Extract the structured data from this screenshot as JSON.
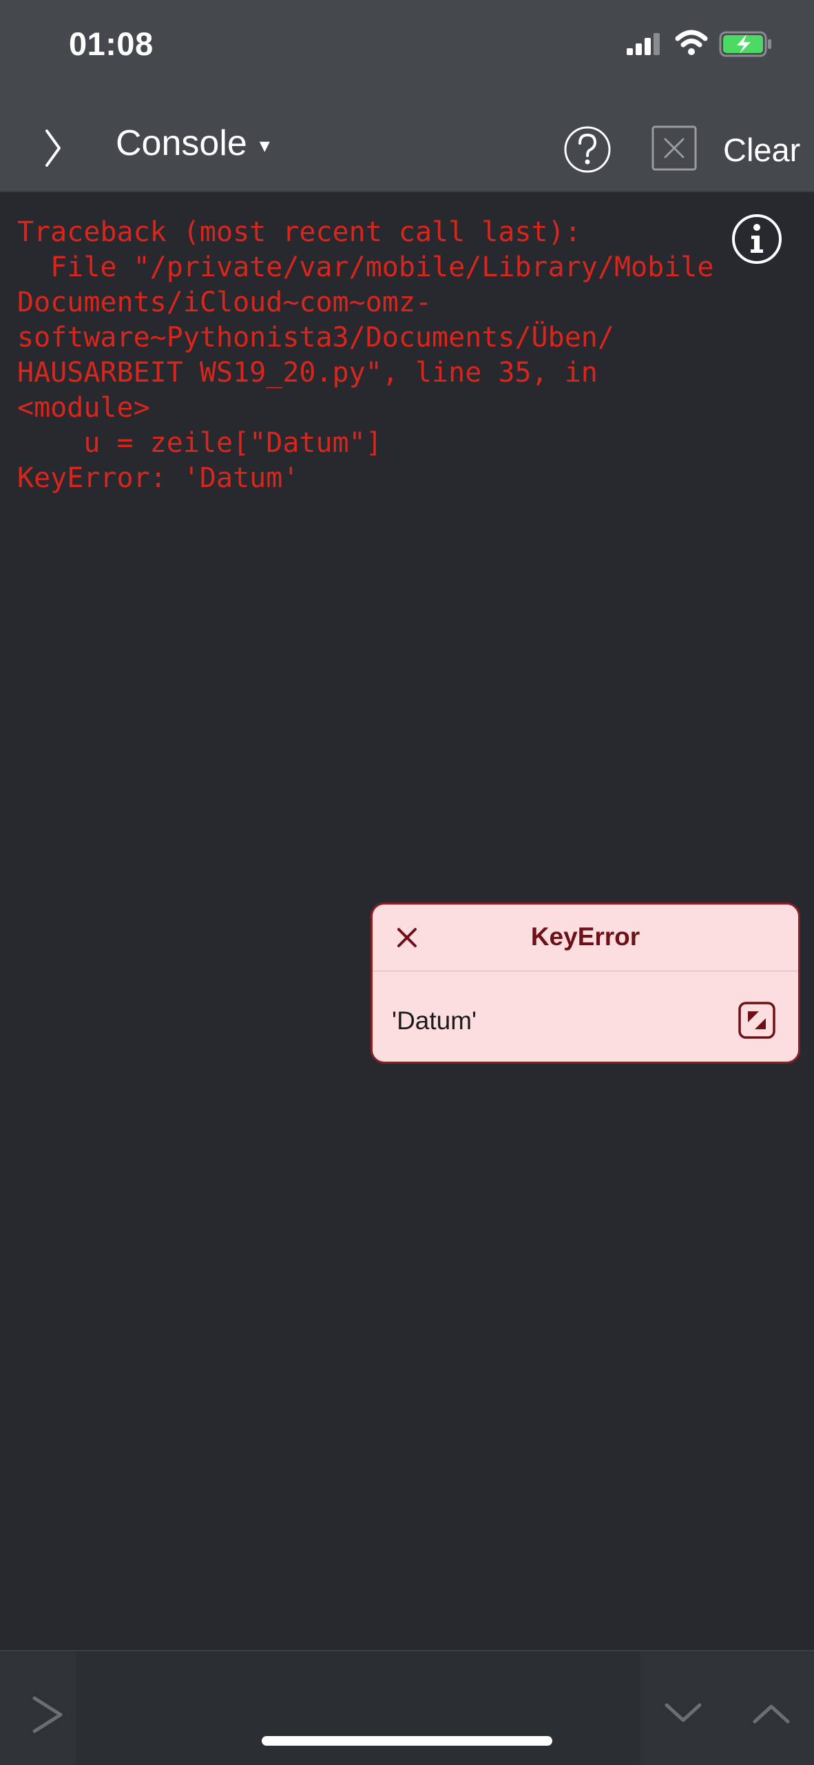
{
  "status_bar": {
    "time": "01:08"
  },
  "toolbar": {
    "title": "Console",
    "title_caret": "▾",
    "clear_label": "Clear"
  },
  "console": {
    "lines": [
      "Traceback (most recent call last):",
      "  File \"/private/var/mobile/Library/Mobile",
      "Documents/iCloud~com~omz-",
      "software~Pythonista3/Documents/Üben/",
      "HAUSARBEIT WS19_20.py\", line 35, in",
      "<module>",
      "    u = zeile[\"Datum\"]",
      "KeyError: 'Datum'"
    ],
    "text_color": "#d9261c"
  },
  "error_popup": {
    "title": "KeyError",
    "message": "'Datum'",
    "background": "#fcdee0",
    "border": "#8a1f26"
  },
  "colors": {
    "background": "#27292e",
    "toolbar": "#45484d",
    "battery_fill": "#4cd964"
  },
  "icons": {
    "sidebar_toggle": "chevron-right-icon",
    "help": "question-circle-icon",
    "clear": "x-square-icon",
    "info": "info-circle-icon",
    "popup_close": "close-icon",
    "popup_expand": "expand-icon",
    "prompt": "prompt-chevron-icon",
    "history_down": "chevron-down-icon",
    "history_up": "chevron-up-icon"
  }
}
